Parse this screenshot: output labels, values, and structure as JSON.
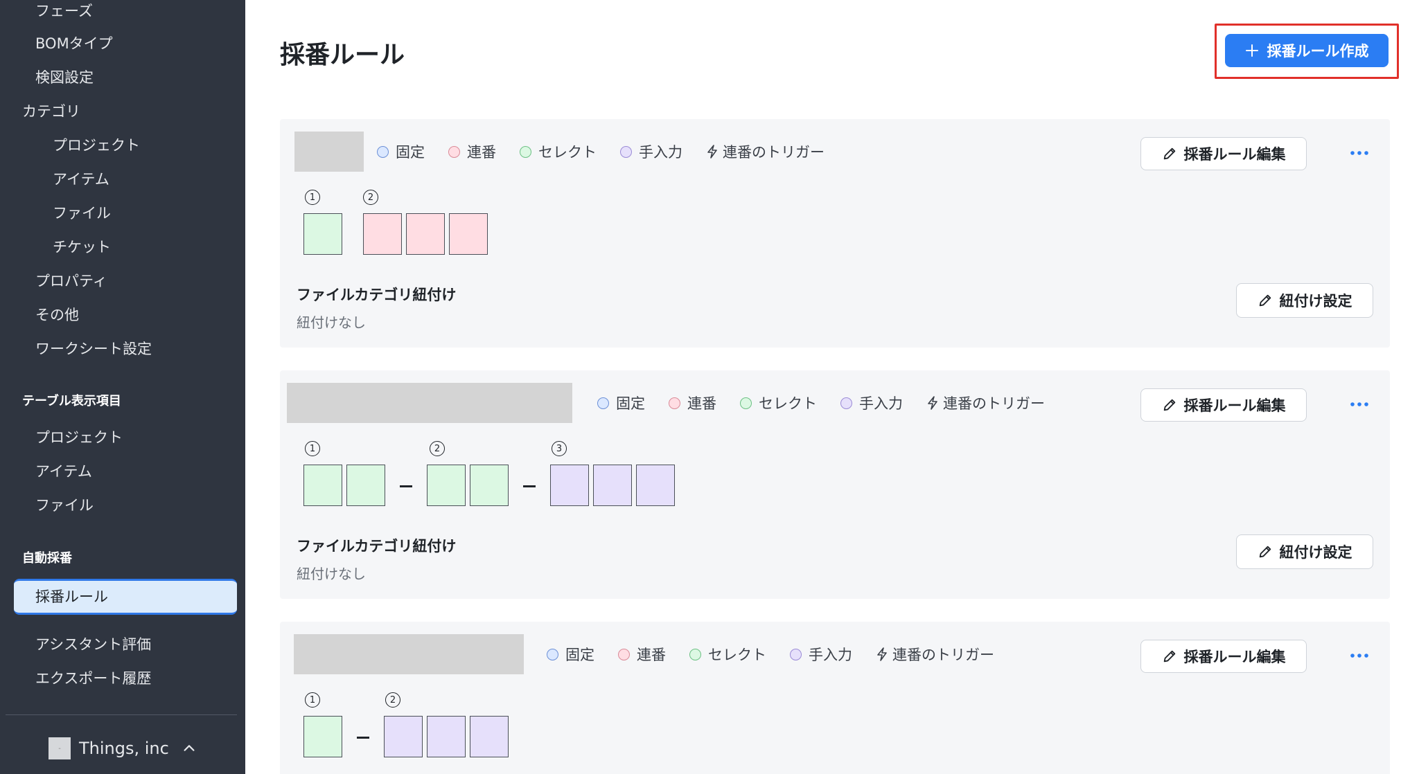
{
  "sidebar": {
    "items": [
      {
        "label": "フェーズ"
      },
      {
        "label": "BOMタイプ"
      },
      {
        "label": "検図設定"
      },
      {
        "label": "カテゴリ"
      },
      {
        "label": "プロジェクト"
      },
      {
        "label": "アイテム"
      },
      {
        "label": "ファイル"
      },
      {
        "label": "チケット"
      },
      {
        "label": "プロパティ"
      },
      {
        "label": "その他"
      },
      {
        "label": "ワークシート設定"
      }
    ],
    "table_section": {
      "heading": "テーブル表示項目",
      "items": [
        {
          "label": "プロジェクト"
        },
        {
          "label": "アイテム"
        },
        {
          "label": "ファイル"
        }
      ]
    },
    "auto_section": {
      "heading": "自動採番",
      "active": "採番ルール",
      "items": [
        {
          "label": "アシスタント評価"
        },
        {
          "label": "エクスポート履歴"
        }
      ]
    },
    "org": {
      "name": "Things, inc",
      "chevron_icon": "chevron-up-icon"
    }
  },
  "header": {
    "title": "採番ルール",
    "create_button": "採番ルール作成"
  },
  "legend": {
    "fixed": "固定",
    "seq": "連番",
    "select": "セレクト",
    "input": "手入力",
    "trigger": "連番のトリガー"
  },
  "colors": {
    "fixed": "#dbe8ff",
    "seq": "#ffdde3",
    "select": "#dcf8e3",
    "input": "#e6e0fb",
    "accent": "#2b7df3",
    "highlight": "#e1302a"
  },
  "card_common": {
    "edit_button": "採番ルール編集",
    "link_title": "ファイルカテゴリ紐付け",
    "link_value": "紐付けなし",
    "link_button": "紐付け設定"
  },
  "rules": [
    {
      "segments": [
        {
          "num": "1",
          "type": "select",
          "count": 1
        },
        {
          "num": "2",
          "type": "seq",
          "count": 3
        }
      ]
    },
    {
      "segments": [
        {
          "num": "1",
          "type": "select",
          "count": 2
        },
        {
          "num": "2",
          "type": "select",
          "count": 2
        },
        {
          "num": "3",
          "type": "input",
          "count": 3
        }
      ]
    },
    {
      "segments": [
        {
          "num": "1",
          "type": "select",
          "count": 1
        },
        {
          "num": "2",
          "type": "input",
          "count": 3
        }
      ]
    }
  ]
}
